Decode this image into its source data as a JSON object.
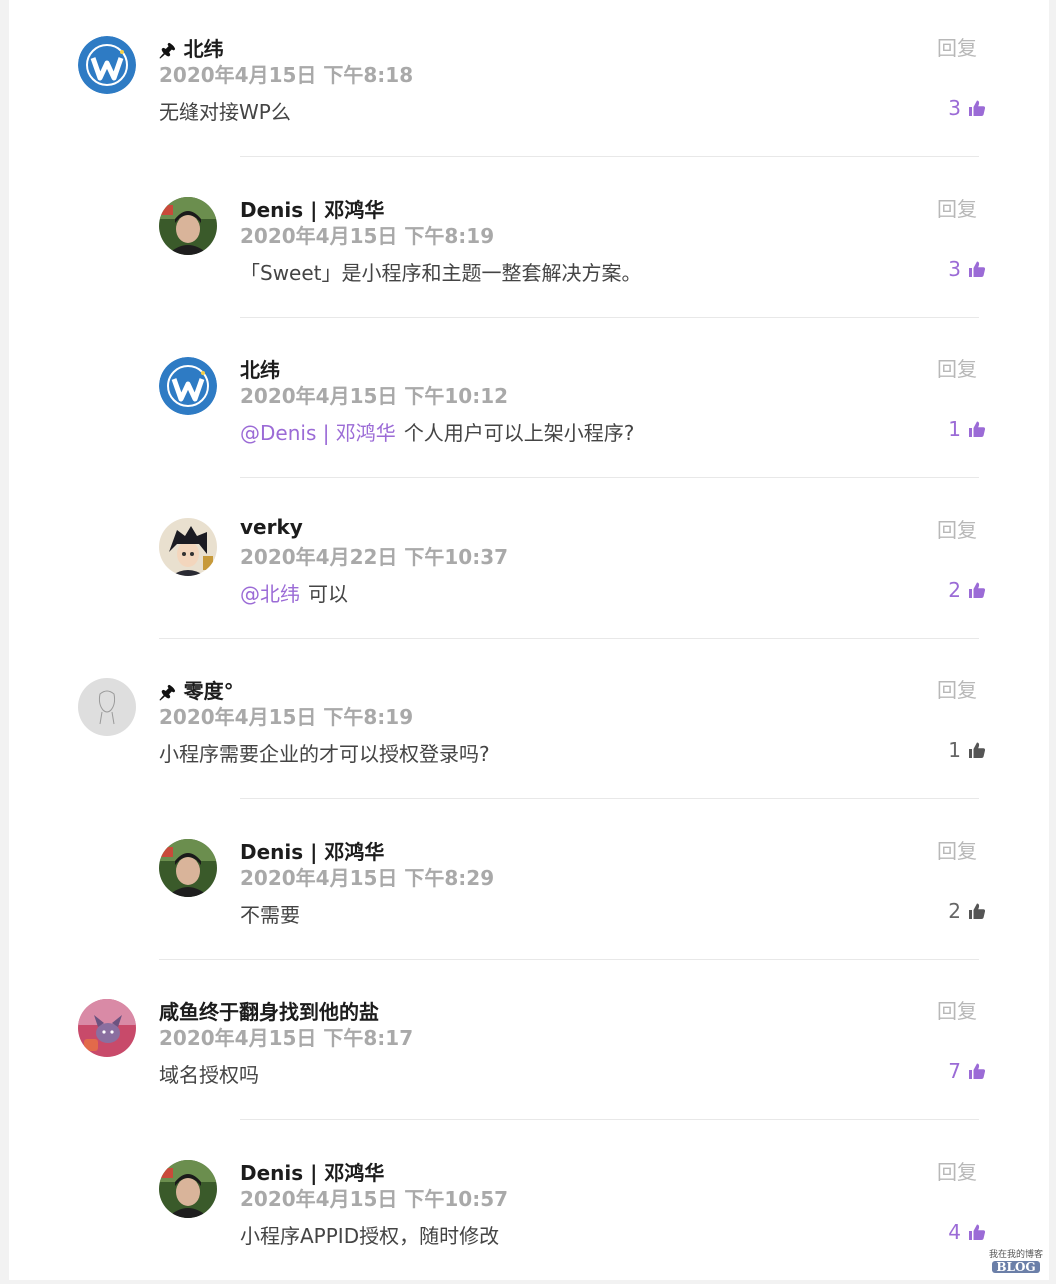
{
  "comments": [
    {
      "pinned": true,
      "pin_icon": "🖈",
      "author": "北纬",
      "date": "2020年4月15日 下午8:18",
      "mention": "",
      "text": "无缝对接WP么",
      "likes": "3",
      "liked": true,
      "reply_label": "回复",
      "avatar": "wordpress-logo",
      "level": 0
    },
    {
      "pinned": false,
      "pin_icon": "",
      "author": "Denis | 邓鸿华",
      "date": "2020年4月15日 下午8:19",
      "mention": "",
      "text": "「Sweet」是小程序和主题一整套解决方案。",
      "likes": "3",
      "liked": true,
      "reply_label": "回复",
      "avatar": "denis-photo",
      "level": 1
    },
    {
      "pinned": false,
      "pin_icon": "",
      "author": "北纬",
      "date": "2020年4月15日 下午10:12",
      "mention": "@Denis | 邓鸿华",
      "text": "个人用户可以上架小程序?",
      "likes": "1",
      "liked": true,
      "reply_label": "回复",
      "avatar": "wordpress-logo",
      "level": 1
    },
    {
      "pinned": false,
      "pin_icon": "",
      "author": "verky",
      "date": "2020年4月22日 下午10:37",
      "mention": "@北纬",
      "text": "可以",
      "likes": "2",
      "liked": true,
      "reply_label": "回复",
      "avatar": "anime-avatar",
      "level": 1
    },
    {
      "pinned": true,
      "pin_icon": "🖈",
      "author": "零度°",
      "date": "2020年4月15日 下午8:19",
      "mention": "",
      "text": "小程序需要企业的才可以授权登录吗?",
      "likes": "1",
      "liked": false,
      "reply_label": "回复",
      "avatar": "sketch-avatar",
      "level": 0
    },
    {
      "pinned": false,
      "pin_icon": "",
      "author": "Denis | 邓鸿华",
      "date": "2020年4月15日 下午8:29",
      "mention": "",
      "text": "不需要",
      "likes": "2",
      "liked": false,
      "reply_label": "回复",
      "avatar": "denis-photo",
      "level": 1
    },
    {
      "pinned": false,
      "pin_icon": "",
      "author": "咸鱼终于翻身找到他的盐",
      "date": "2020年4月15日 下午8:17",
      "mention": "",
      "text": "域名授权吗",
      "likes": "7",
      "liked": true,
      "reply_label": "回复",
      "avatar": "cartoon-avatar",
      "level": 0
    },
    {
      "pinned": false,
      "pin_icon": "",
      "author": "Denis | 邓鸿华",
      "date": "2020年4月15日 下午10:57",
      "mention": "",
      "text": "小程序APPID授权，随时修改",
      "likes": "4",
      "liked": true,
      "reply_label": "回复",
      "avatar": "denis-photo",
      "level": 1
    }
  ],
  "colors": {
    "accent": "#9b6bd6",
    "muted": "#a9a9a9",
    "reply": "#b8b8b8",
    "wordpress": "#2e7bc4"
  },
  "watermark": {
    "line1": "我在我的博客",
    "line2": "BLOG"
  }
}
